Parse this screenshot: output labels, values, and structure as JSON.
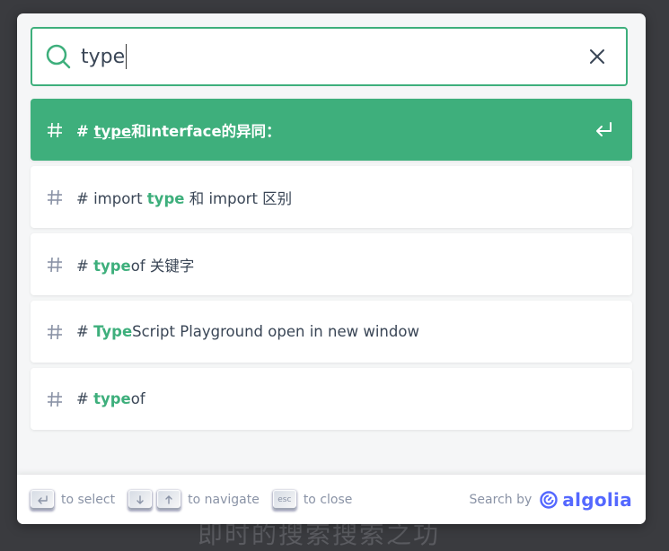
{
  "search": {
    "query": "type"
  },
  "hits": [
    {
      "selected": true,
      "parts": [
        [
          "# ",
          false
        ],
        [
          "type",
          true
        ],
        [
          "和interface的异同：",
          false
        ]
      ]
    },
    {
      "selected": false,
      "parts": [
        [
          "# import ",
          false
        ],
        [
          "type",
          true
        ],
        [
          " 和 import 区别",
          false
        ]
      ]
    },
    {
      "selected": false,
      "parts": [
        [
          "# ",
          false
        ],
        [
          "type",
          true
        ],
        [
          "of 关键字",
          false
        ]
      ]
    },
    {
      "selected": false,
      "parts": [
        [
          "# ",
          false
        ],
        [
          "Type",
          true
        ],
        [
          "Script Playground open in new window",
          false
        ]
      ]
    },
    {
      "selected": false,
      "parts": [
        [
          "# ",
          false
        ],
        [
          "type",
          true
        ],
        [
          "of",
          false
        ]
      ]
    }
  ],
  "footer": {
    "select_label": "to select",
    "navigate_label": "to navigate",
    "close_label": "to close",
    "esc_key": "esc",
    "search_by": "Search by",
    "brand": "algolia"
  },
  "colors": {
    "accent": "#3eaf7c",
    "brand": "#5468ff"
  },
  "background_text": "即时的搜索搜索之功"
}
